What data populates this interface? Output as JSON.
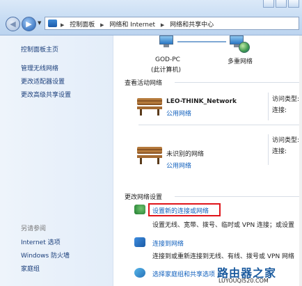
{
  "breadcrumb": {
    "items": [
      "控制面板",
      "网络和 Internet",
      "网络和共享中心"
    ]
  },
  "sidebar": {
    "home": "控制面板主页",
    "links": [
      "管理无线网络",
      "更改适配器设置",
      "更改高级共享设置"
    ],
    "see_also_title": "另请参阅",
    "see_also": [
      "Internet 选项",
      "Windows 防火墙",
      "家庭组"
    ]
  },
  "map": {
    "pc_name": "GOD-PC",
    "pc_sub": "(此计算机)",
    "network": "多重网络"
  },
  "active": {
    "title": "查看活动网络",
    "networks": [
      {
        "name": "LEO-THINK_Network",
        "type": "公用网络",
        "access": "访问类型:",
        "conn": "连接:"
      },
      {
        "name": "未识别的网络",
        "type": "公用网络",
        "access": "访问类型:",
        "conn": "连接:"
      }
    ]
  },
  "change": {
    "title": "更改网络设置",
    "tasks": [
      {
        "label": "设置新的连接或网络",
        "desc": "设置无线、宽带、拨号、临时或 VPN 连接；或设置"
      },
      {
        "label": "连接到网络",
        "desc": "连接到或重新连接到无线、有线、拨号或 VPN 网络"
      },
      {
        "label": "选择家庭组和共享选项",
        "desc": ""
      }
    ]
  },
  "watermark": {
    "title": "路由器之家",
    "url": "LUYOUQI520.COM"
  }
}
